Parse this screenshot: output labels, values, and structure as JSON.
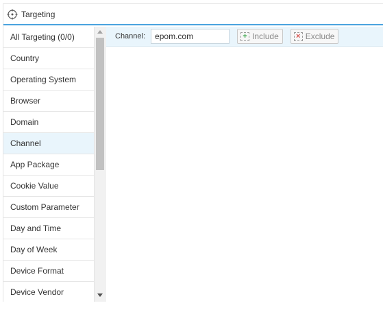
{
  "header": {
    "title": "Targeting",
    "icon": "crosshair-icon"
  },
  "sidebar": {
    "items": [
      {
        "label": "All Targeting (0/0)"
      },
      {
        "label": "Country"
      },
      {
        "label": "Operating System"
      },
      {
        "label": "Browser"
      },
      {
        "label": "Domain"
      },
      {
        "label": "Channel",
        "active": true
      },
      {
        "label": "App Package"
      },
      {
        "label": "Cookie Value"
      },
      {
        "label": "Custom Parameter"
      },
      {
        "label": "Day and Time"
      },
      {
        "label": "Day of Week"
      },
      {
        "label": "Device Format"
      },
      {
        "label": "Device Vendor"
      }
    ]
  },
  "toolbar": {
    "field_label": "Channel:",
    "field_value": "epom.com",
    "include_label": "Include",
    "exclude_label": "Exclude"
  },
  "colors": {
    "accent": "#4aa3df",
    "active_bg": "#e9f5fc",
    "include": "#3aa54a",
    "exclude": "#d9534f"
  }
}
